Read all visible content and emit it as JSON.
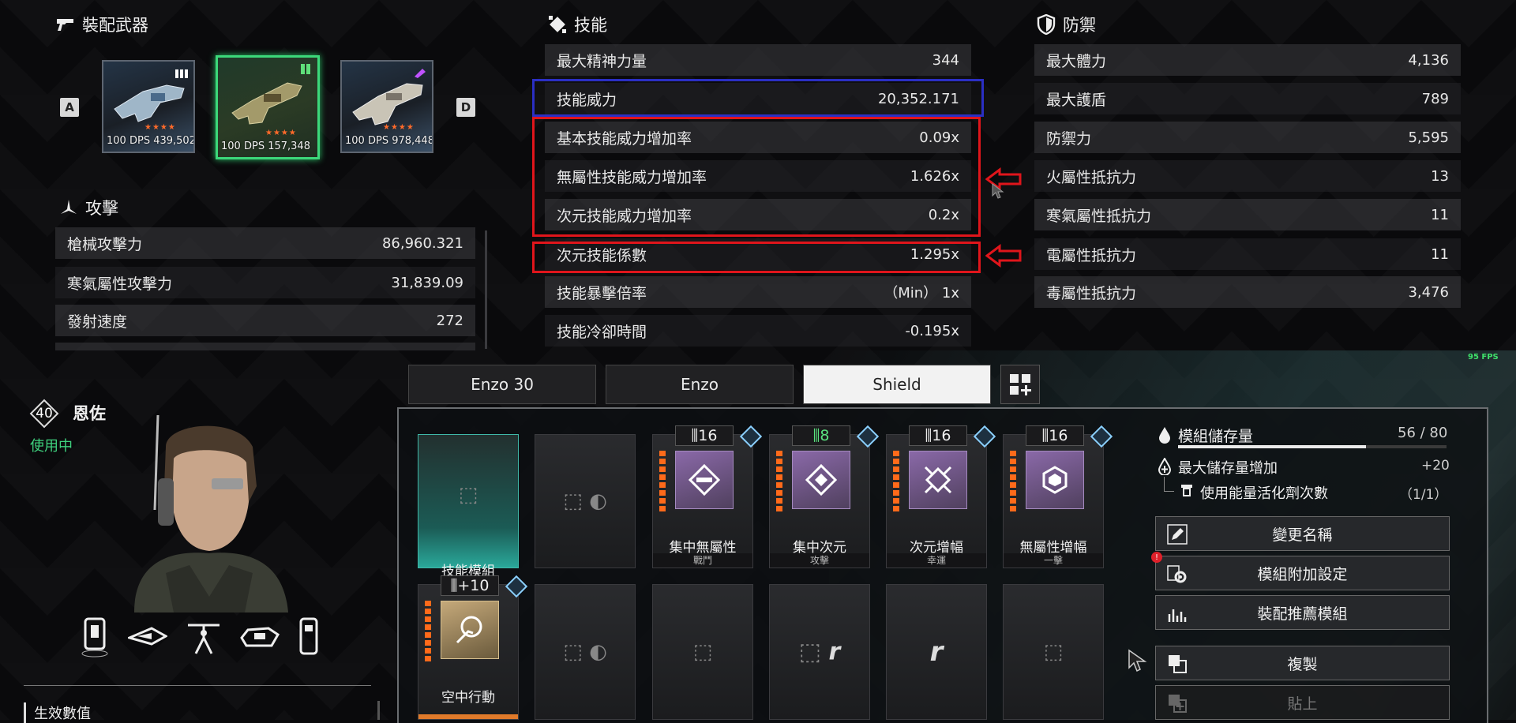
{
  "weapons_section": {
    "title": "裝配武器",
    "key_left": "A",
    "key_right": "D",
    "items": [
      {
        "level": "100",
        "dps_label": "DPS",
        "dps": "439,502",
        "stars": "★★★★",
        "tag": "ammo-icon"
      },
      {
        "level": "100",
        "dps_label": "DPS",
        "dps": "157,348",
        "stars": "★★★★",
        "tag": "green-ammo-icon"
      },
      {
        "level": "100",
        "dps_label": "DPS",
        "dps": "978,448",
        "stars": "★★★★",
        "tag": "purple-ammo-icon"
      }
    ]
  },
  "attack_section": {
    "title": "攻擊",
    "rows": [
      {
        "label": "槍械攻擊力",
        "value": "86,960.321"
      },
      {
        "label": "寒氣屬性攻擊力",
        "value": "31,839.09"
      },
      {
        "label": "發射速度",
        "value": "272"
      }
    ]
  },
  "skill_section": {
    "title": "技能",
    "rows": [
      {
        "label": "最大精神力量",
        "value": "344"
      },
      {
        "label": "技能威力",
        "value": "20,352.171"
      },
      {
        "label": "基本技能威力增加率",
        "value": "0.09x"
      },
      {
        "label": "無屬性技能威力增加率",
        "value": "1.626x"
      },
      {
        "label": "次元技能威力增加率",
        "value": "0.2x"
      },
      {
        "label": "次元技能係數",
        "value": "1.295x"
      },
      {
        "label": "技能暴擊倍率",
        "value": "（Min） 1x"
      },
      {
        "label": "技能冷卻時間",
        "value": "-0.195x"
      }
    ]
  },
  "defense_section": {
    "title": "防禦",
    "rows": [
      {
        "label": "最大體力",
        "value": "4,136"
      },
      {
        "label": "最大護盾",
        "value": "789"
      },
      {
        "label": "防禦力",
        "value": "5,595"
      },
      {
        "label": "火屬性抵抗力",
        "value": "13"
      },
      {
        "label": "寒氣屬性抵抗力",
        "value": "11"
      },
      {
        "label": "電屬性抵抗力",
        "value": "11"
      },
      {
        "label": "毒屬性抵抗力",
        "value": "3,476"
      }
    ]
  },
  "character": {
    "level": "40",
    "name": "恩佐",
    "status": "使用中",
    "effective_values_label": "生效數值"
  },
  "fps": "95 FPS",
  "preset_tabs": [
    "Enzo 30",
    "Enzo",
    "Shield"
  ],
  "modules": {
    "row1": [
      {
        "name": "技能模組",
        "type": "skill-slot"
      },
      {
        "name": "",
        "type": "empty-c"
      },
      {
        "cap": "16",
        "name": "集中無屬性",
        "sub": "戰鬥"
      },
      {
        "cap": "8",
        "name": "集中次元",
        "sub": "攻擊"
      },
      {
        "cap": "16",
        "name": "次元增幅",
        "sub": "幸運"
      },
      {
        "cap": "16",
        "name": "無屬性增幅",
        "sub": "一擊"
      }
    ],
    "row2": [
      {
        "cap": "+10",
        "name": "空中行動"
      },
      {
        "name": "",
        "type": "empty-c"
      },
      {
        "name": "",
        "type": "empty"
      },
      {
        "name": "",
        "type": "empty-r"
      },
      {
        "name": "",
        "type": "r"
      },
      {
        "name": "",
        "type": "empty"
      }
    ]
  },
  "capacity": {
    "label": "模組儲存量",
    "value": "56 / 80",
    "fill_fraction": 0.7,
    "increase_label": "最大儲存量增加",
    "increase_value": "+20",
    "activator_label": "使用能量活化劑次數",
    "activator_value": "（1/1）"
  },
  "actions": {
    "rename": "變更名稱",
    "extra_settings": "模組附加設定",
    "recommend": "裝配推薦模組",
    "copy": "複製",
    "paste": "貼上"
  }
}
